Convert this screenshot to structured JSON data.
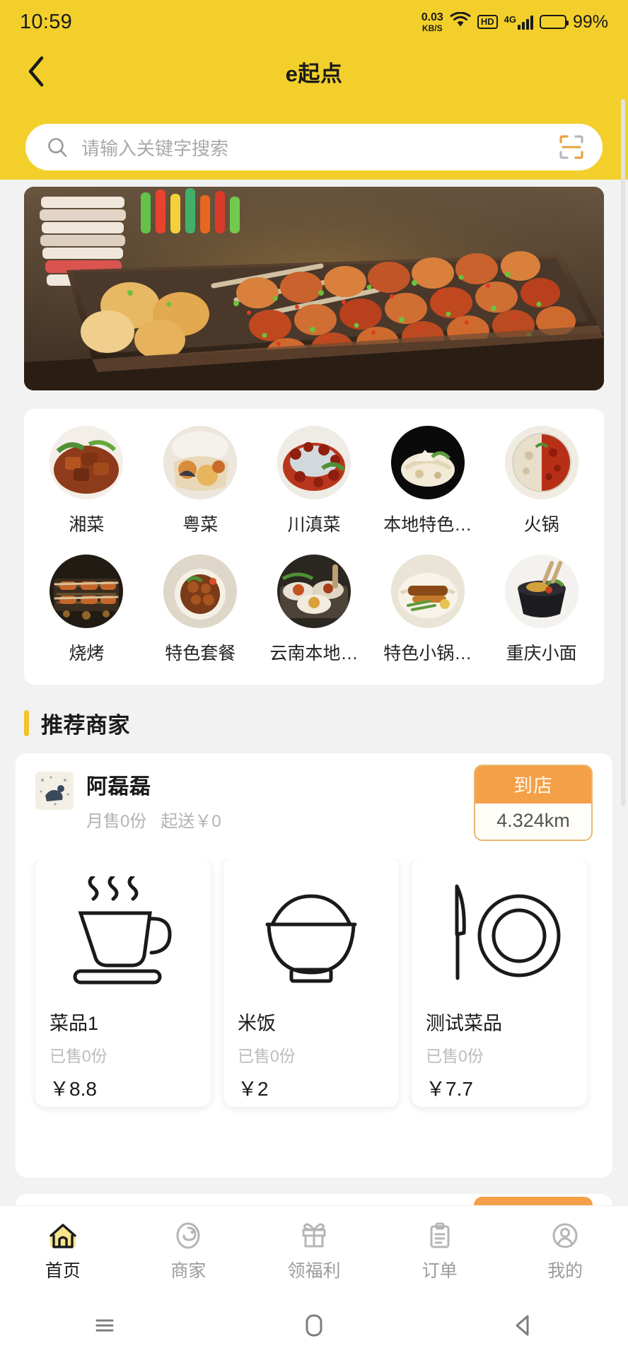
{
  "statusbar": {
    "time": "10:59",
    "net_rate": "0.03",
    "net_unit": "KB/S",
    "wifi_icon": "wifi-icon",
    "hd_label": "HD",
    "network_label": "4G",
    "battery_percent": "99%"
  },
  "header": {
    "back_icon": "back-chevron-icon",
    "title": "e起点",
    "bg_color": "#f2cf2b"
  },
  "search": {
    "icon": "search-icon",
    "placeholder": "请输入关键字搜索",
    "scan_icon": "scan-qr-icon"
  },
  "banner": {
    "alt": "street-food-grill-banner"
  },
  "categories": {
    "rows": [
      [
        {
          "label": "湘菜",
          "thumb": "braised-pork-thumb"
        },
        {
          "label": "粤菜",
          "thumb": "cantonese-dish-thumb"
        },
        {
          "label": "川滇菜",
          "thumb": "sichuan-dish-thumb"
        },
        {
          "label": "本地特色…",
          "thumb": "local-specialty-thumb"
        },
        {
          "label": "火锅",
          "thumb": "hotpot-thumb"
        }
      ],
      [
        {
          "label": "烧烤",
          "thumb": "bbq-thumb"
        },
        {
          "label": "特色套餐",
          "thumb": "set-meal-thumb"
        },
        {
          "label": "云南本地…",
          "thumb": "yunnan-local-thumb"
        },
        {
          "label": "特色小锅…",
          "thumb": "small-pot-thumb"
        },
        {
          "label": "重庆小面",
          "thumb": "chongqing-noodles-thumb"
        }
      ]
    ]
  },
  "section": {
    "recommended_title": "推荐商家",
    "accent_color": "#f2c32b"
  },
  "merchant": {
    "avatar": "merchant-avatar",
    "name": "阿磊磊",
    "monthly_sales": "月售0份",
    "delivery_min": "起送￥0",
    "badge_label": "到店",
    "distance": "4.324km",
    "badge_color": "#f4a049",
    "dishes": [
      {
        "name": "菜品1",
        "sold": "已售0份",
        "price": "￥8.8",
        "icon": "coffee-cup-icon"
      },
      {
        "name": "米饭",
        "sold": "已售0份",
        "price": "￥2",
        "icon": "rice-bowl-icon"
      },
      {
        "name": "测试菜品",
        "sold": "已售0份",
        "price": "￥7.7",
        "icon": "knife-plate-icon"
      }
    ]
  },
  "tabbar": {
    "items": [
      {
        "label": "首页",
        "icon": "home-icon",
        "active": true
      },
      {
        "label": "商家",
        "icon": "merchant-icon",
        "active": false
      },
      {
        "label": "领福利",
        "icon": "gift-icon",
        "active": false
      },
      {
        "label": "订单",
        "icon": "order-clipboard-icon",
        "active": false
      },
      {
        "label": "我的",
        "icon": "profile-icon",
        "active": false
      }
    ],
    "active_color": "#1a1a1a",
    "inactive_color": "#9b9b9b"
  },
  "sysnav": {
    "menu_icon": "android-menu-icon",
    "home_icon": "android-home-icon",
    "back_icon": "android-back-icon"
  }
}
